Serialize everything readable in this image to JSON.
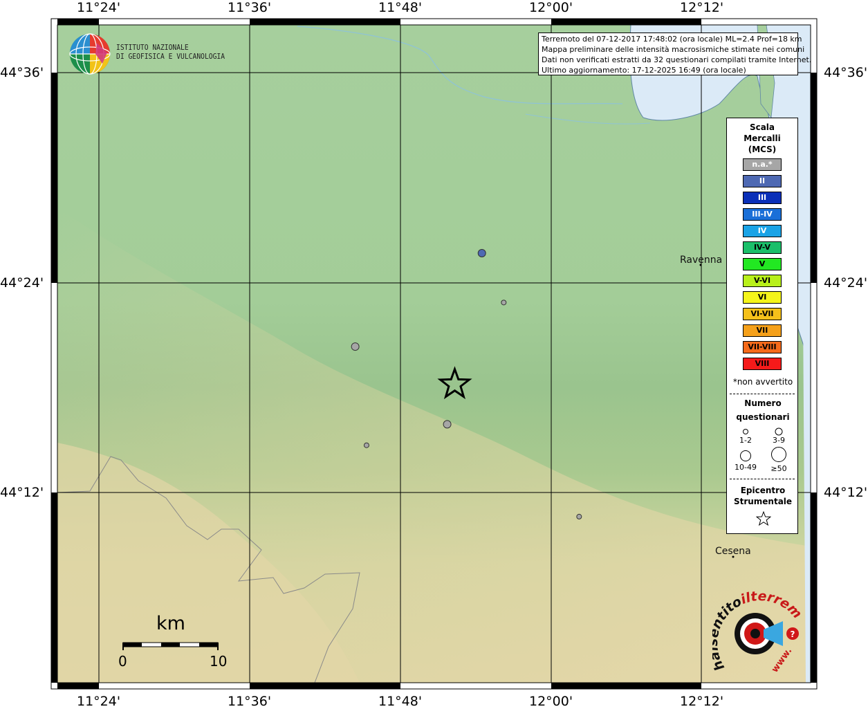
{
  "axes": {
    "top_ticks": [
      "11°24'",
      "11°36'",
      "11°48'",
      "12°00'",
      "12°12'"
    ],
    "bottom_ticks": [
      "11°24'",
      "11°36'",
      "11°48'",
      "12°00'",
      "12°12'"
    ],
    "left_ticks": [
      "44°36'",
      "44°24'",
      "44°12'"
    ],
    "right_ticks": [
      "44°36'",
      "44°24'",
      "44°12'"
    ]
  },
  "info": {
    "line1": "Terremoto del 07-12-2017 17:48:02 (ora locale) ML=2.4 Prof=18 km",
    "line2": "Mappa preliminare delle intensità macrosismiche stimate nei comuni",
    "line3": "Dati non verificati estratti da 32 questionari compilati tramite Internet.",
    "line4": "Ultimo aggiornamento: 17-12-2025 16:49 (ora locale)"
  },
  "ingv": {
    "line1": "ISTITUTO NAZIONALE",
    "line2": "DI GEOFISICA E VULCANOLOGIA"
  },
  "legend": {
    "title1": "Scala",
    "title2": "Mercalli",
    "title3": "(MCS)",
    "classes": [
      {
        "label": "n.a.*",
        "color": "#a6a6a6",
        "text_color": "#ffffff"
      },
      {
        "label": "II",
        "color": "#4e69b3",
        "text_color": "#ffffff"
      },
      {
        "label": "III",
        "color": "#0a2fb8",
        "text_color": "#ffffff"
      },
      {
        "label": "III-IV",
        "color": "#1a6fd8",
        "text_color": "#ffffff"
      },
      {
        "label": "IV",
        "color": "#1aa3e6",
        "text_color": "#ffffff"
      },
      {
        "label": "IV-V",
        "color": "#1bbf6a",
        "text_color": "#000000"
      },
      {
        "label": "V",
        "color": "#22e822",
        "text_color": "#000000"
      },
      {
        "label": "V-VI",
        "color": "#b8f01a",
        "text_color": "#000000"
      },
      {
        "label": "VI",
        "color": "#f5f51a",
        "text_color": "#000000"
      },
      {
        "label": "VI-VII",
        "color": "#f5c01a",
        "text_color": "#000000"
      },
      {
        "label": "VII",
        "color": "#f5a01a",
        "text_color": "#000000"
      },
      {
        "label": "VII-VIII",
        "color": "#f56a1a",
        "text_color": "#000000"
      },
      {
        "label": "VIII",
        "color": "#f51a1a",
        "text_color": "#000000"
      }
    ],
    "na_note": "*non avvertito",
    "count_title1": "Numero",
    "count_title2": "questionari",
    "count_1": "1-2",
    "count_2": "3-9",
    "count_3": "10-49",
    "count_4": "≥50",
    "epi_title1": "Epicentro",
    "epi_title2": "Strumentale"
  },
  "places": {
    "city1": "Ravenna",
    "city2": "Cesena"
  },
  "scalebar": {
    "unit": "km",
    "start": "0",
    "end": "10"
  },
  "observations": [
    {
      "lon": 11.908,
      "lat": 44.428,
      "intensity": "II",
      "count_class": "3-9",
      "color": "#4e69b3"
    },
    {
      "lon": 11.937,
      "lat": 44.381,
      "intensity": "n.a.*",
      "count_class": "1-2",
      "color": "#a6a6a6"
    },
    {
      "lon": 11.74,
      "lat": 44.339,
      "intensity": "n.a.*",
      "count_class": "3-9",
      "color": "#a6a6a6"
    },
    {
      "lon": 11.862,
      "lat": 44.265,
      "intensity": "n.a.*",
      "count_class": "3-9",
      "color": "#a6a6a6"
    },
    {
      "lon": 11.755,
      "lat": 44.245,
      "intensity": "n.a.*",
      "count_class": "1-2",
      "color": "#a6a6a6"
    },
    {
      "lon": 12.037,
      "lat": 44.177,
      "intensity": "n.a.*",
      "count_class": "1-2",
      "color": "#a6a6a6"
    }
  ],
  "epicenter": {
    "lon": 11.872,
    "lat": 44.303
  },
  "hsit_logo": {
    "text": "haisentitoilterremoto.it",
    "text_a": "haisentito",
    "text_b": "ilterremoto.it",
    "www": "www."
  }
}
